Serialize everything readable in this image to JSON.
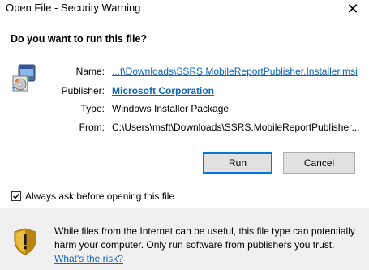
{
  "window": {
    "title": "Open File - Security Warning",
    "close_glyph": "✕"
  },
  "question": "Do you want to run this file?",
  "file_icon": "msi-installer-icon",
  "fields": {
    "name_label": "Name:",
    "name_value": "...t\\Downloads\\SSRS.MobileReportPublisher.Installer.msi",
    "publisher_label": "Publisher:",
    "publisher_value": "Microsoft Corporation",
    "type_label": "Type:",
    "type_value": "Windows Installer Package",
    "from_label": "From:",
    "from_value": "C:\\Users\\msft\\Downloads\\SSRS.MobileReportPublisher..."
  },
  "buttons": {
    "run_label": "Run",
    "cancel_label": "Cancel"
  },
  "checkbox": {
    "label": "Always ask before opening this file",
    "checked": true
  },
  "footer": {
    "shield_icon": "security-shield-icon",
    "warning_text": "While files from the Internet can be useful, this file type can potentially harm your computer. Only run software from publishers you trust.",
    "risk_link": "What's the risk?"
  },
  "colors": {
    "link": "#0b66c2",
    "footer_bg": "#f0f0f0",
    "button_bg": "#e1e1e1",
    "default_button_border": "#0078d7"
  }
}
